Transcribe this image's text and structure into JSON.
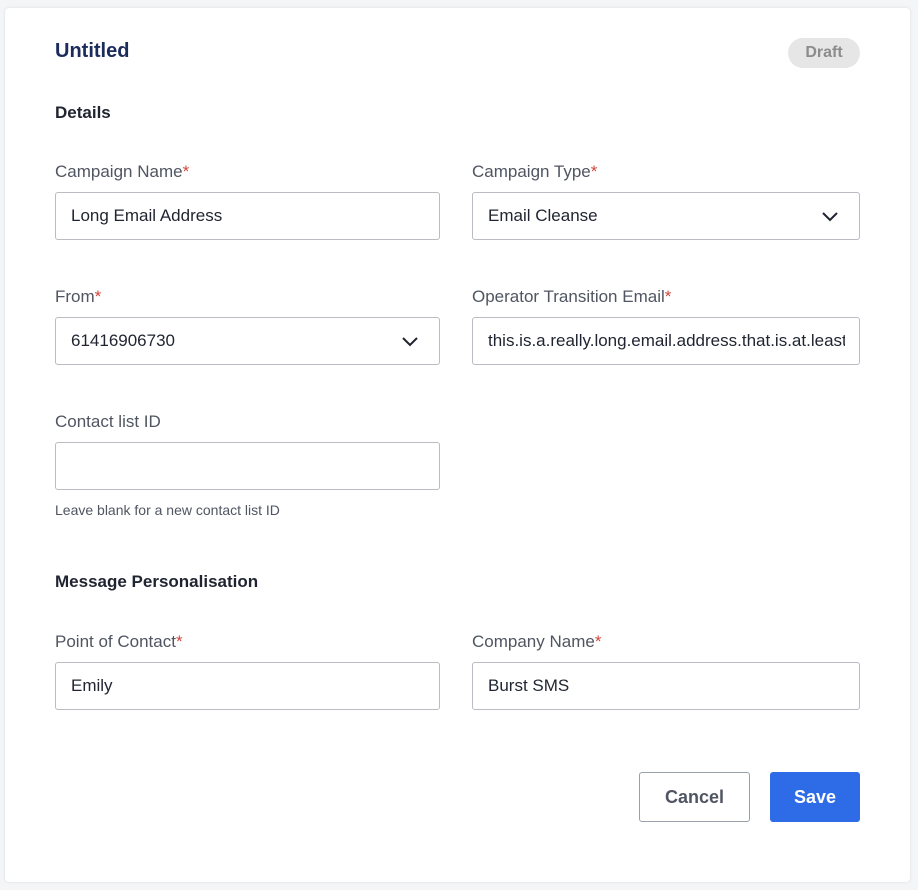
{
  "header": {
    "title": "Untitled",
    "status_badge": "Draft"
  },
  "sections": {
    "details": "Details",
    "personalisation": "Message Personalisation"
  },
  "fields": {
    "campaign_name": {
      "label": "Campaign Name",
      "required_mark": "*",
      "value": "Long Email Address"
    },
    "campaign_type": {
      "label": "Campaign Type",
      "required_mark": "*",
      "value": "Email Cleanse"
    },
    "from": {
      "label": "From",
      "required_mark": "*",
      "value": "61416906730"
    },
    "operator_email": {
      "label": "Operator Transition Email",
      "required_mark": "*",
      "value": "this.is.a.really.long.email.address.that.is.at.least"
    },
    "contact_list_id": {
      "label": "Contact list ID",
      "value": "",
      "help": "Leave blank for a new contact list ID"
    },
    "point_of_contact": {
      "label": "Point of Contact",
      "required_mark": "*",
      "value": "Emily"
    },
    "company_name": {
      "label": "Company Name",
      "required_mark": "*",
      "value": "Burst SMS"
    }
  },
  "actions": {
    "cancel": "Cancel",
    "save": "Save"
  },
  "icons": {
    "select_arrow": "chevron-down-icon"
  },
  "colors": {
    "accent": "#2e6be6",
    "title": "#1b2b5c",
    "required": "#d0463c"
  }
}
